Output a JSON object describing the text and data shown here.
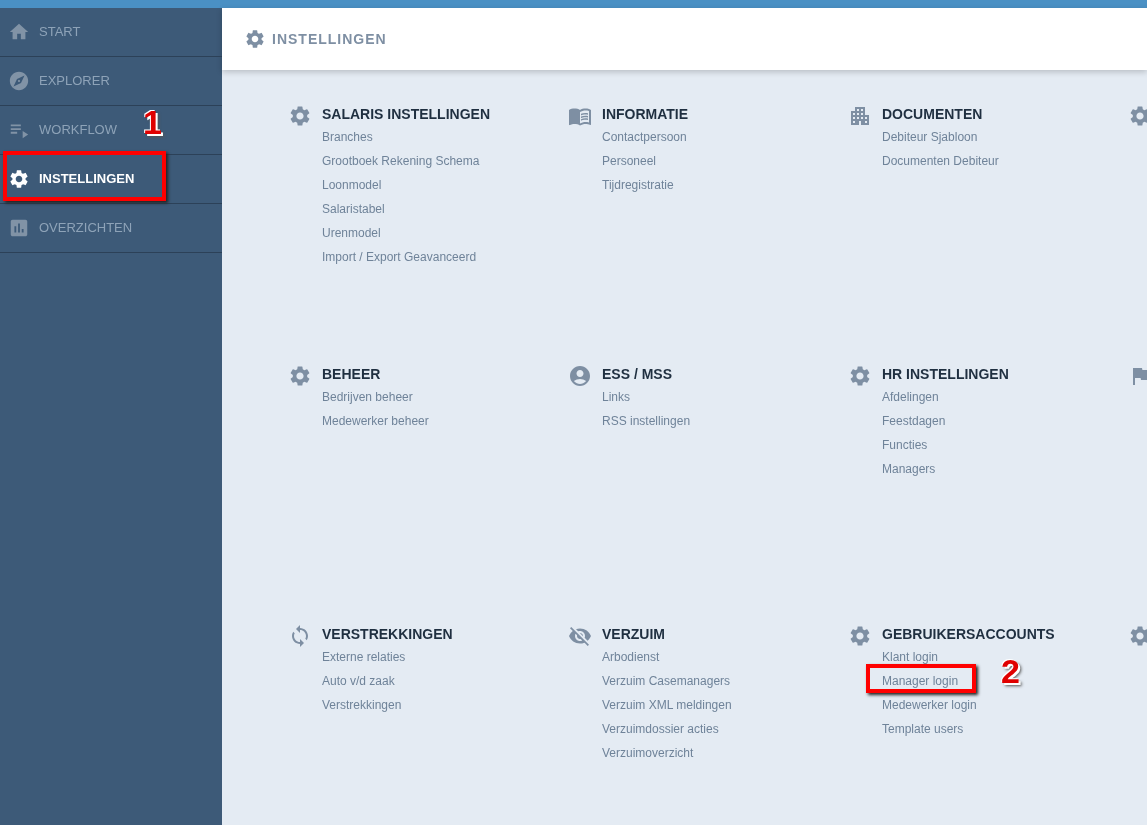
{
  "sidebar": {
    "items": [
      {
        "label": "START",
        "selected": false
      },
      {
        "label": "EXPLORER",
        "selected": false
      },
      {
        "label": "WORKFLOW",
        "selected": false
      },
      {
        "label": "INSTELLINGEN",
        "selected": true,
        "annotation": "1"
      },
      {
        "label": "OVERZICHTEN",
        "selected": false
      }
    ]
  },
  "header": {
    "title": "INSTELLINGEN"
  },
  "sections": [
    {
      "title": "SALARIS INSTELLINGEN",
      "links": [
        {
          "label": "Branches"
        },
        {
          "label": "Grootboek Rekening Schema"
        },
        {
          "label": "Loonmodel"
        },
        {
          "label": "Salaristabel"
        },
        {
          "label": "Urenmodel"
        },
        {
          "label": "Import / Export Geavanceerd"
        }
      ]
    },
    {
      "title": "INFORMATIE",
      "links": [
        {
          "label": "Contactpersoon"
        },
        {
          "label": "Personeel"
        },
        {
          "label": "Tijdregistratie"
        }
      ]
    },
    {
      "title": "DOCUMENTEN",
      "links": [
        {
          "label": "Debiteur Sjabloon"
        },
        {
          "label": "Documenten Debiteur"
        }
      ]
    },
    {
      "title": "BEHEER",
      "links": [
        {
          "label": "Bedrijven beheer"
        },
        {
          "label": "Medewerker beheer"
        }
      ]
    },
    {
      "title": "ESS / MSS",
      "links": [
        {
          "label": "Links"
        },
        {
          "label": "RSS instellingen"
        }
      ]
    },
    {
      "title": "HR INSTELLINGEN",
      "links": [
        {
          "label": "Afdelingen"
        },
        {
          "label": "Feestdagen"
        },
        {
          "label": "Functies"
        },
        {
          "label": "Managers"
        }
      ]
    },
    {
      "title": "VERSTREKKINGEN",
      "links": [
        {
          "label": "Externe relaties"
        },
        {
          "label": "Auto v/d zaak"
        },
        {
          "label": "Verstrekkingen"
        }
      ]
    },
    {
      "title": "VERZUIM",
      "links": [
        {
          "label": "Arbodienst"
        },
        {
          "label": "Verzuim Casemanagers"
        },
        {
          "label": "Verzuim XML meldingen"
        },
        {
          "label": "Verzuimdossier acties"
        },
        {
          "label": "Verzuimoverzicht"
        }
      ]
    },
    {
      "title": "GEBRUIKERSACCOUNTS",
      "links": [
        {
          "label": "Klant login"
        },
        {
          "label": "Manager login",
          "annotation": "2"
        },
        {
          "label": "Medewerker login"
        },
        {
          "label": "Template users"
        }
      ]
    }
  ]
}
